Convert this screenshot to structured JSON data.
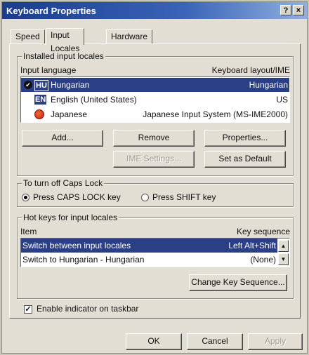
{
  "window": {
    "title": "Keyboard Properties",
    "help_label": "?",
    "close_label": "×"
  },
  "tabs": [
    {
      "label": "Speed"
    },
    {
      "label": "Input Locales",
      "active": true
    },
    {
      "label": "Hardware"
    }
  ],
  "installed": {
    "legend": "Installed input locales",
    "col_language": "Input language",
    "col_layout": "Keyboard layout/IME",
    "rows": [
      {
        "badge": "HU",
        "language": "Hungarian",
        "layout": "Hungarian",
        "selected": true
      },
      {
        "badge": "EN",
        "language": "English (United States)",
        "layout": "US",
        "selected": false
      },
      {
        "badge": "",
        "language": "Japanese",
        "layout": "Japanese Input System (MS-IME2000)",
        "selected": false
      }
    ],
    "buttons": {
      "add": "Add...",
      "remove": "Remove",
      "properties": "Properties...",
      "ime_settings": "IME Settings...",
      "set_default": "Set as Default"
    }
  },
  "caps": {
    "legend": "To turn off Caps Lock",
    "option1": "Press CAPS LOCK key",
    "option2": "Press SHIFT key",
    "selected": "option1"
  },
  "hotkeys": {
    "legend": "Hot keys for input locales",
    "col_item": "Item",
    "col_seq": "Key sequence",
    "rows": [
      {
        "item": "Switch between input locales",
        "seq": "Left Alt+Shift",
        "selected": true
      },
      {
        "item": "Switch to Hungarian - Hungarian",
        "seq": "(None)",
        "selected": false
      }
    ],
    "change_button": "Change Key Sequence..."
  },
  "indicator": {
    "label": "Enable indicator on taskbar",
    "checked": true
  },
  "footer": {
    "ok": "OK",
    "cancel": "Cancel",
    "apply": "Apply"
  },
  "colors": {
    "selection": "#2b3f86",
    "titlebar": "#1a3c8c",
    "dialog_bg": "#e2ded3"
  }
}
